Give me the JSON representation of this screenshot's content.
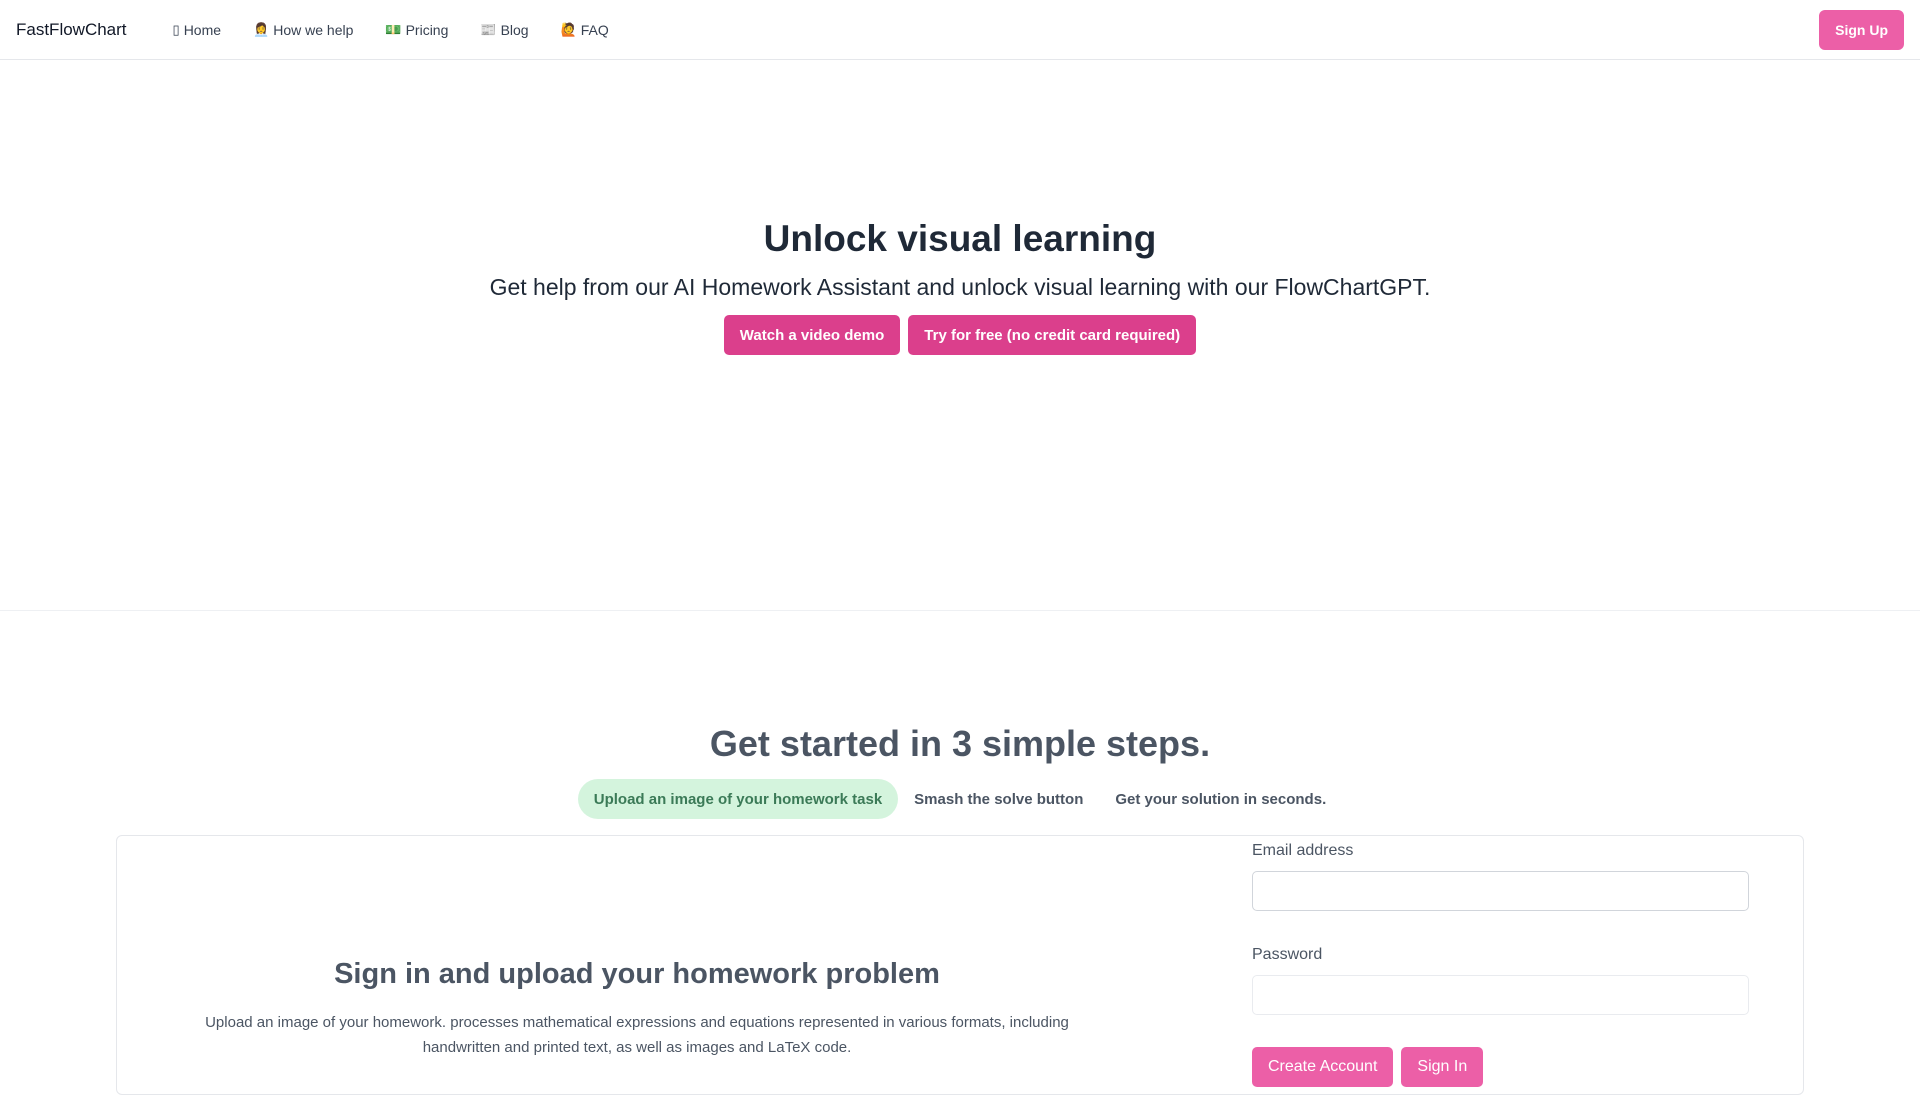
{
  "header": {
    "logo": "FastFlowChart",
    "nav": [
      {
        "icon": "▯",
        "label": "Home"
      },
      {
        "icon": "👩‍💼",
        "label": "How we help"
      },
      {
        "icon": "💵",
        "label": "Pricing"
      },
      {
        "icon": "📰",
        "label": "Blog"
      },
      {
        "icon": "🙋",
        "label": "FAQ"
      }
    ],
    "signup_label": "Sign Up"
  },
  "hero": {
    "title": "Unlock visual learning",
    "subtitle": "Get help from our AI Homework Assistant and unlock visual learning with our FlowChartGPT.",
    "demo_label": "Watch a video demo",
    "try_label": "Try for free (no credit card required)"
  },
  "steps": {
    "title": "Get started in 3 simple steps.",
    "tabs": [
      {
        "label": "Upload an image of your homework task",
        "active": true
      },
      {
        "label": "Smash the solve button",
        "active": false
      },
      {
        "label": "Get your solution in seconds.",
        "active": false
      }
    ]
  },
  "card": {
    "title": "Sign in and upload your homework problem",
    "description": "Upload an image of your homework. processes mathematical expressions and equations represented in various formats, including handwritten and printed text, as well as images and LaTeX code.",
    "form": {
      "email_label": "Email address",
      "email_value": "",
      "password_label": "Password",
      "password_value": "",
      "create_label": "Create Account",
      "signin_label": "Sign In"
    }
  },
  "colors": {
    "primary_pink": "#db3f8c",
    "soft_pink": "#ec5fa7",
    "active_tab_bg": "#d4f4dd",
    "active_tab_text": "#3b7a57"
  }
}
